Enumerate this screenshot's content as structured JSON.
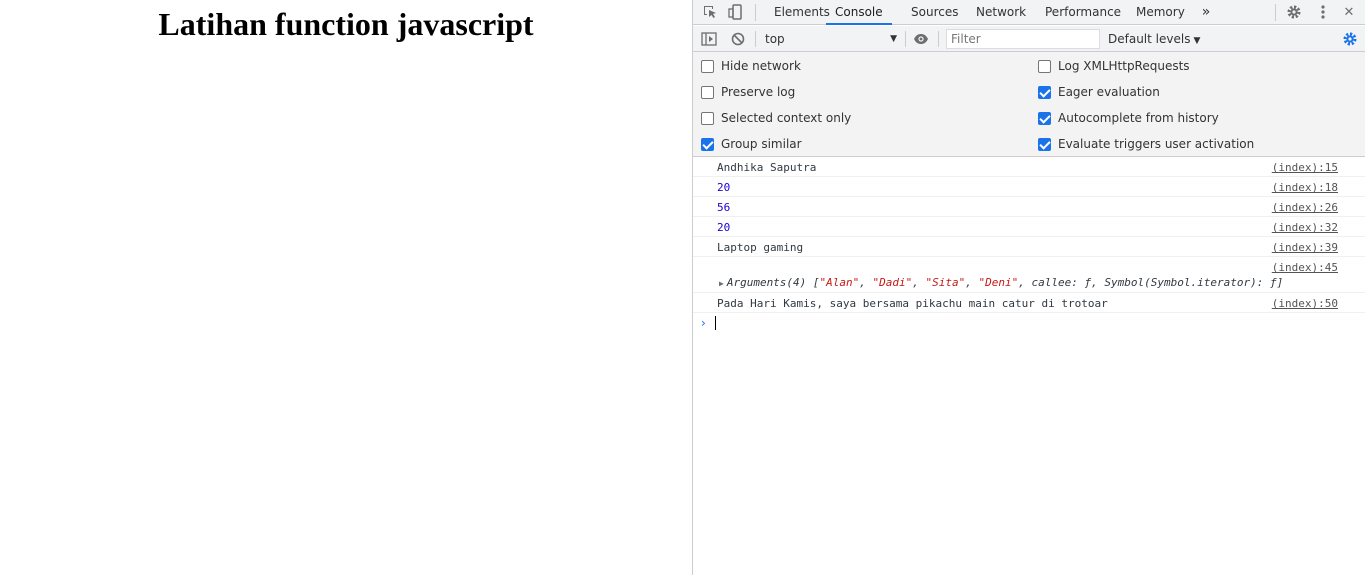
{
  "page": {
    "heading": "Latihan function javascript"
  },
  "devtools": {
    "tabs": [
      "Elements",
      "Console",
      "Sources",
      "Network",
      "Performance",
      "Memory"
    ],
    "active_tab": "Console",
    "more_tabs_icon": "chevron-double-right",
    "toolbar": {
      "context": "top",
      "filter_placeholder": "Filter",
      "levels": "Default levels"
    },
    "settings": {
      "left": [
        {
          "label": "Hide network",
          "checked": false
        },
        {
          "label": "Preserve log",
          "checked": false
        },
        {
          "label": "Selected context only",
          "checked": false
        },
        {
          "label": "Group similar",
          "checked": true
        }
      ],
      "right": [
        {
          "label": "Log XMLHttpRequests",
          "checked": false
        },
        {
          "label": "Eager evaluation",
          "checked": true
        },
        {
          "label": "Autocomplete from history",
          "checked": true
        },
        {
          "label": "Evaluate triggers user activation",
          "checked": true
        }
      ]
    },
    "console": {
      "messages": [
        {
          "text": "Andhika Saputra",
          "source": "(index):15",
          "type": "string"
        },
        {
          "text": "20",
          "source": "(index):18",
          "type": "number"
        },
        {
          "text": "56",
          "source": "(index):26",
          "type": "number"
        },
        {
          "text": "20",
          "source": "(index):32",
          "type": "number"
        },
        {
          "text": "Laptop gaming",
          "source": "(index):39",
          "type": "string"
        },
        {
          "text": "",
          "source": "(index):45",
          "type": "object"
        },
        {
          "text": "Pada Hari Kamis, saya bersama pikachu main catur di trotoar",
          "source": "(index):50",
          "type": "string"
        }
      ],
      "arguments": {
        "prefix": "Arguments(4) [",
        "items": [
          "\"Alan\"",
          "\"Dadi\"",
          "\"Sita\"",
          "\"Deni\""
        ],
        "suffix": ", callee: ƒ, Symbol(Symbol.iterator): ƒ]"
      }
    },
    "colors": {
      "accent": "#1a73e8",
      "number": "#1c00cf",
      "string_literal": "#c41a16"
    }
  }
}
